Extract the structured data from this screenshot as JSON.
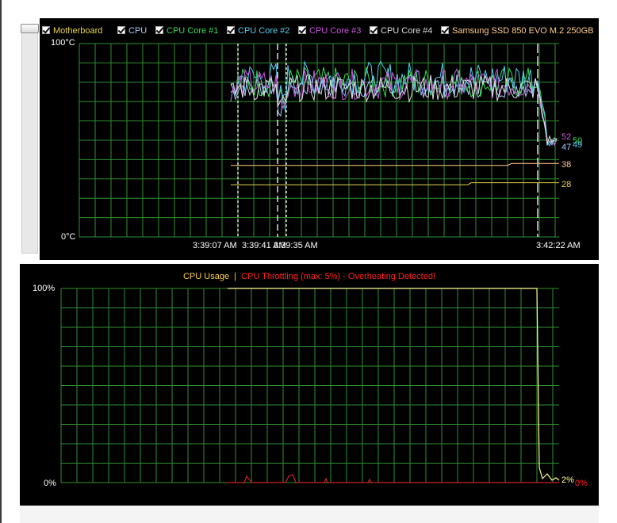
{
  "legend": [
    {
      "label": "Motherboard",
      "color": "#e8d44d",
      "checked": true
    },
    {
      "label": "CPU",
      "color": "#a8c8ff",
      "checked": true
    },
    {
      "label": "CPU Core #1",
      "color": "#33dd55",
      "checked": true
    },
    {
      "label": "CPU Core #2",
      "color": "#55ccee",
      "checked": true
    },
    {
      "label": "CPU Core #3",
      "color": "#cc55dd",
      "checked": true
    },
    {
      "label": "CPU Core #4",
      "color": "#dddddd",
      "checked": true
    },
    {
      "label": "Samsung SSD 850 EVO M.2 250GB",
      "color": "#ffcc88",
      "checked": true
    }
  ],
  "temp_chart": {
    "y_max_label": "100°C",
    "y_min_label": "0°C",
    "time_labels": [
      "3:39:07 AM",
      "3:39:41 AM",
      "3:39:35 AM",
      "3:42:22 AM"
    ],
    "end_values": [
      {
        "text": "52",
        "color": "#cc55dd"
      },
      {
        "text": "50",
        "color": "#33dd55"
      },
      {
        "text": "49",
        "color": "#55ccee"
      },
      {
        "text": "47",
        "color": "#a8c8ff"
      },
      {
        "text": "38",
        "color": "#ffcc88"
      },
      {
        "text": "28",
        "color": "#e8d44d"
      }
    ]
  },
  "usage_chart": {
    "title_usage": "CPU Usage",
    "title_sep": "|",
    "title_throttle": "CPU Throttling (max: 5%) - Overheating Detected!",
    "y_max_label": "100%",
    "y_min_label": "0%",
    "end_usage": "2%",
    "end_throttle": "0%",
    "usage_color": "#ffff99",
    "throttle_color": "#cc2222",
    "throttle_text_color": "#ff2222"
  },
  "grid_color": "#2f8f2f"
}
